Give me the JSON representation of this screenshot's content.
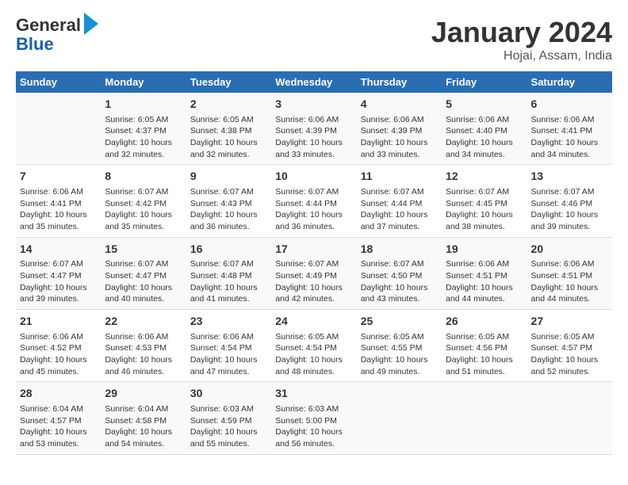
{
  "logo": {
    "general": "General",
    "blue": "Blue"
  },
  "title": "January 2024",
  "subtitle": "Hojai, Assam, India",
  "days_of_week": [
    "Sunday",
    "Monday",
    "Tuesday",
    "Wednesday",
    "Thursday",
    "Friday",
    "Saturday"
  ],
  "weeks": [
    [
      {
        "day": "",
        "info": ""
      },
      {
        "day": "1",
        "info": "Sunrise: 6:05 AM\nSunset: 4:37 PM\nDaylight: 10 hours\nand 32 minutes."
      },
      {
        "day": "2",
        "info": "Sunrise: 6:05 AM\nSunset: 4:38 PM\nDaylight: 10 hours\nand 32 minutes."
      },
      {
        "day": "3",
        "info": "Sunrise: 6:06 AM\nSunset: 4:39 PM\nDaylight: 10 hours\nand 33 minutes."
      },
      {
        "day": "4",
        "info": "Sunrise: 6:06 AM\nSunset: 4:39 PM\nDaylight: 10 hours\nand 33 minutes."
      },
      {
        "day": "5",
        "info": "Sunrise: 6:06 AM\nSunset: 4:40 PM\nDaylight: 10 hours\nand 34 minutes."
      },
      {
        "day": "6",
        "info": "Sunrise: 6:06 AM\nSunset: 4:41 PM\nDaylight: 10 hours\nand 34 minutes."
      }
    ],
    [
      {
        "day": "7",
        "info": "Sunrise: 6:06 AM\nSunset: 4:41 PM\nDaylight: 10 hours\nand 35 minutes."
      },
      {
        "day": "8",
        "info": "Sunrise: 6:07 AM\nSunset: 4:42 PM\nDaylight: 10 hours\nand 35 minutes."
      },
      {
        "day": "9",
        "info": "Sunrise: 6:07 AM\nSunset: 4:43 PM\nDaylight: 10 hours\nand 36 minutes."
      },
      {
        "day": "10",
        "info": "Sunrise: 6:07 AM\nSunset: 4:44 PM\nDaylight: 10 hours\nand 36 minutes."
      },
      {
        "day": "11",
        "info": "Sunrise: 6:07 AM\nSunset: 4:44 PM\nDaylight: 10 hours\nand 37 minutes."
      },
      {
        "day": "12",
        "info": "Sunrise: 6:07 AM\nSunset: 4:45 PM\nDaylight: 10 hours\nand 38 minutes."
      },
      {
        "day": "13",
        "info": "Sunrise: 6:07 AM\nSunset: 4:46 PM\nDaylight: 10 hours\nand 39 minutes."
      }
    ],
    [
      {
        "day": "14",
        "info": "Sunrise: 6:07 AM\nSunset: 4:47 PM\nDaylight: 10 hours\nand 39 minutes."
      },
      {
        "day": "15",
        "info": "Sunrise: 6:07 AM\nSunset: 4:47 PM\nDaylight: 10 hours\nand 40 minutes."
      },
      {
        "day": "16",
        "info": "Sunrise: 6:07 AM\nSunset: 4:48 PM\nDaylight: 10 hours\nand 41 minutes."
      },
      {
        "day": "17",
        "info": "Sunrise: 6:07 AM\nSunset: 4:49 PM\nDaylight: 10 hours\nand 42 minutes."
      },
      {
        "day": "18",
        "info": "Sunrise: 6:07 AM\nSunset: 4:50 PM\nDaylight: 10 hours\nand 43 minutes."
      },
      {
        "day": "19",
        "info": "Sunrise: 6:06 AM\nSunset: 4:51 PM\nDaylight: 10 hours\nand 44 minutes."
      },
      {
        "day": "20",
        "info": "Sunrise: 6:06 AM\nSunset: 4:51 PM\nDaylight: 10 hours\nand 44 minutes."
      }
    ],
    [
      {
        "day": "21",
        "info": "Sunrise: 6:06 AM\nSunset: 4:52 PM\nDaylight: 10 hours\nand 45 minutes."
      },
      {
        "day": "22",
        "info": "Sunrise: 6:06 AM\nSunset: 4:53 PM\nDaylight: 10 hours\nand 46 minutes."
      },
      {
        "day": "23",
        "info": "Sunrise: 6:06 AM\nSunset: 4:54 PM\nDaylight: 10 hours\nand 47 minutes."
      },
      {
        "day": "24",
        "info": "Sunrise: 6:05 AM\nSunset: 4:54 PM\nDaylight: 10 hours\nand 48 minutes."
      },
      {
        "day": "25",
        "info": "Sunrise: 6:05 AM\nSunset: 4:55 PM\nDaylight: 10 hours\nand 49 minutes."
      },
      {
        "day": "26",
        "info": "Sunrise: 6:05 AM\nSunset: 4:56 PM\nDaylight: 10 hours\nand 51 minutes."
      },
      {
        "day": "27",
        "info": "Sunrise: 6:05 AM\nSunset: 4:57 PM\nDaylight: 10 hours\nand 52 minutes."
      }
    ],
    [
      {
        "day": "28",
        "info": "Sunrise: 6:04 AM\nSunset: 4:57 PM\nDaylight: 10 hours\nand 53 minutes."
      },
      {
        "day": "29",
        "info": "Sunrise: 6:04 AM\nSunset: 4:58 PM\nDaylight: 10 hours\nand 54 minutes."
      },
      {
        "day": "30",
        "info": "Sunrise: 6:03 AM\nSunset: 4:59 PM\nDaylight: 10 hours\nand 55 minutes."
      },
      {
        "day": "31",
        "info": "Sunrise: 6:03 AM\nSunset: 5:00 PM\nDaylight: 10 hours\nand 56 minutes."
      },
      {
        "day": "",
        "info": ""
      },
      {
        "day": "",
        "info": ""
      },
      {
        "day": "",
        "info": ""
      }
    ]
  ]
}
